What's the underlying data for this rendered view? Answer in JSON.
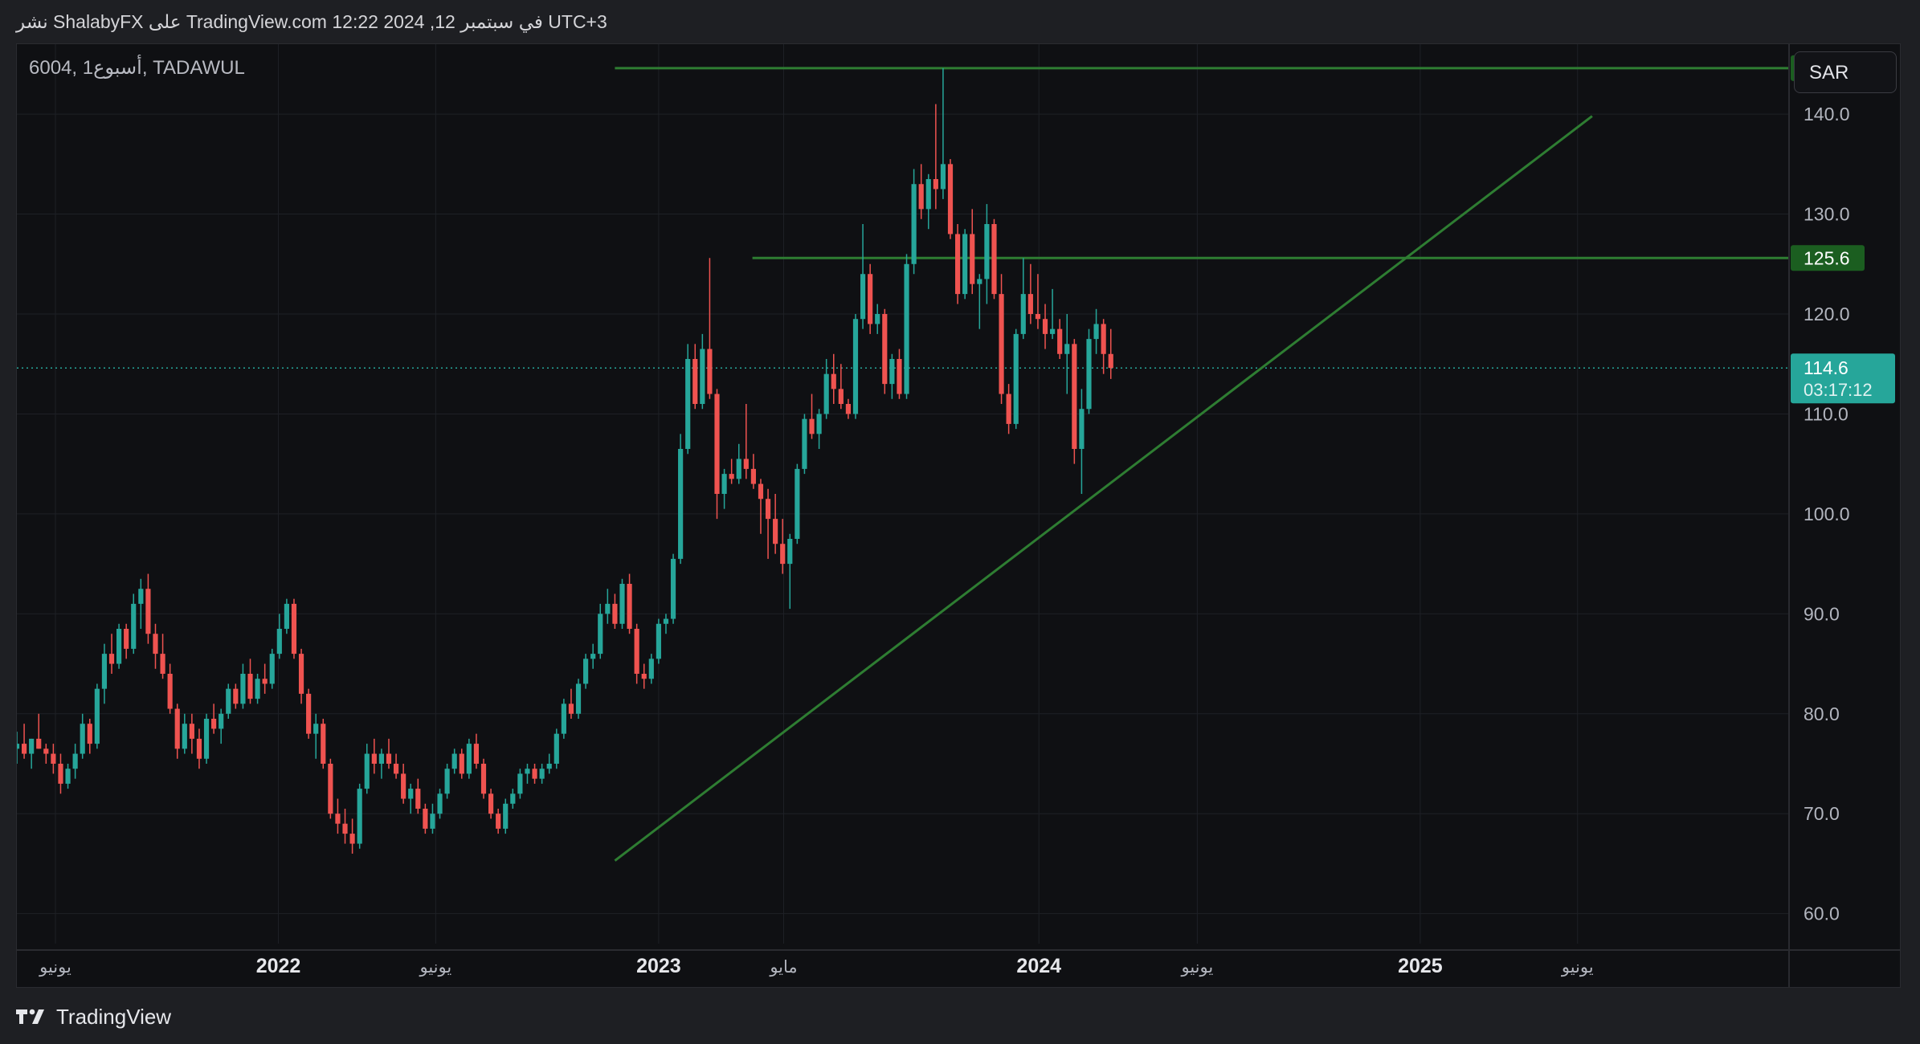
{
  "header": {
    "caption": "نشر ShalabyFX على TradingView.com في سبتمبر 12, 2024 12:22 UTC+3"
  },
  "chart_header": {
    "symbol": "6004, 1أسبوع, TADAWUL",
    "currency": "SAR"
  },
  "footer": {
    "brand": "TradingView",
    "logo_icon": "tradingview-logo-icon"
  },
  "colors": {
    "background": "#0f1013",
    "up": "#26a69a",
    "down": "#ef5350",
    "level_line": "#2e7d32",
    "level_label_bg": "#1b5e20",
    "last_price_bg": "#26a69a",
    "grid": "#1e2026",
    "axis_text": "#b2b5be"
  },
  "chart_data": {
    "type": "candlestick",
    "timeframe": "1W",
    "xlim": [
      "2021-04-25",
      "2025-12-21"
    ],
    "ylim": [
      57,
      147
    ],
    "grid": true,
    "y_ticks": [
      {
        "value": 140,
        "label": "140.0"
      },
      {
        "value": 130,
        "label": "130.0"
      },
      {
        "value": 120,
        "label": "120.0"
      },
      {
        "value": 110,
        "label": "110.0"
      },
      {
        "value": 100,
        "label": "100.0"
      },
      {
        "value": 90,
        "label": "90.0"
      },
      {
        "value": 80,
        "label": "80.0"
      },
      {
        "value": 70,
        "label": "70.0"
      },
      {
        "value": 60,
        "label": "60.0"
      }
    ],
    "x_ticks": [
      {
        "date": "2021-06-01",
        "label": "يونيو",
        "bold": false
      },
      {
        "date": "2022-01-01",
        "label": "2022",
        "bold": true
      },
      {
        "date": "2022-06-01",
        "label": "يونيو",
        "bold": false
      },
      {
        "date": "2023-01-01",
        "label": "2023",
        "bold": true
      },
      {
        "date": "2023-05-01",
        "label": "مايو",
        "bold": false
      },
      {
        "date": "2024-01-01",
        "label": "2024",
        "bold": true
      },
      {
        "date": "2024-06-01",
        "label": "يونيو",
        "bold": false
      },
      {
        "date": "2025-01-01",
        "label": "2025",
        "bold": true
      },
      {
        "date": "2025-06-01",
        "label": "يونيو",
        "bold": false
      }
    ],
    "levels": [
      {
        "price": 144.6,
        "label": "144.6",
        "start": "2022-11-20"
      },
      {
        "price": 125.6,
        "label": "125.6",
        "start": "2023-04-01"
      }
    ],
    "trendline": {
      "from": {
        "date": "2022-11-20",
        "price": 65.3
      },
      "to": {
        "date": "2025-06-15",
        "price": 139.8
      }
    },
    "last_price": {
      "value": 114.6,
      "label": "114.6",
      "countdown": "03:17:12"
    },
    "candles_start": "2021-04-25",
    "candles": [
      [
        76.5,
        78.2,
        75.0,
        77.0
      ],
      [
        77.0,
        79.0,
        75.5,
        76.0
      ],
      [
        76.0,
        77.5,
        74.5,
        77.5
      ],
      [
        77.5,
        80.0,
        76.5,
        76.5
      ],
      [
        76.5,
        77.0,
        75.0,
        76.0
      ],
      [
        76.0,
        77.0,
        74.0,
        75.0
      ],
      [
        75.0,
        76.0,
        72.0,
        73.0
      ],
      [
        73.0,
        75.0,
        72.5,
        74.5
      ],
      [
        74.5,
        77.0,
        73.5,
        76.0
      ],
      [
        76.0,
        80.0,
        75.5,
        79.0
      ],
      [
        79.0,
        79.5,
        76.0,
        77.0
      ],
      [
        77.0,
        83.0,
        76.5,
        82.5
      ],
      [
        82.5,
        87.0,
        81.0,
        86.0
      ],
      [
        86.0,
        88.0,
        84.0,
        85.0
      ],
      [
        85.0,
        89.0,
        84.5,
        88.5
      ],
      [
        88.5,
        89.0,
        85.5,
        86.5
      ],
      [
        86.5,
        92.0,
        86.0,
        91.0
      ],
      [
        91.0,
        93.5,
        88.5,
        92.5
      ],
      [
        92.5,
        94.0,
        87.0,
        88.0
      ],
      [
        88.0,
        89.0,
        84.5,
        86.0
      ],
      [
        86.0,
        88.0,
        83.5,
        84.0
      ],
      [
        84.0,
        85.0,
        80.0,
        80.5
      ],
      [
        80.5,
        81.0,
        75.5,
        76.5
      ],
      [
        76.5,
        80.0,
        76.0,
        79.0
      ],
      [
        79.0,
        80.0,
        76.0,
        77.5
      ],
      [
        77.5,
        78.5,
        74.5,
        75.5
      ],
      [
        75.5,
        80.0,
        75.0,
        79.5
      ],
      [
        79.5,
        81.0,
        78.0,
        78.5
      ],
      [
        78.5,
        80.5,
        77.0,
        80.0
      ],
      [
        80.0,
        83.0,
        79.5,
        82.5
      ],
      [
        82.5,
        83.0,
        80.5,
        81.0
      ],
      [
        81.0,
        85.0,
        80.5,
        84.0
      ],
      [
        84.0,
        85.5,
        81.0,
        81.5
      ],
      [
        81.5,
        84.0,
        81.0,
        83.5
      ],
      [
        83.5,
        85.0,
        82.0,
        83.0
      ],
      [
        83.0,
        86.5,
        82.5,
        86.0
      ],
      [
        86.0,
        90.0,
        85.5,
        88.5
      ],
      [
        88.5,
        91.5,
        88.0,
        91.0
      ],
      [
        91.0,
        91.5,
        85.5,
        86.0
      ],
      [
        86.0,
        86.5,
        81.0,
        82.0
      ],
      [
        82.0,
        82.5,
        77.5,
        78.0
      ],
      [
        78.0,
        80.0,
        75.5,
        79.0
      ],
      [
        79.0,
        79.5,
        74.5,
        75.0
      ],
      [
        75.0,
        75.5,
        69.5,
        70.0
      ],
      [
        70.0,
        71.5,
        68.0,
        69.0
      ],
      [
        69.0,
        70.5,
        67.0,
        68.0
      ],
      [
        68.0,
        69.5,
        66.0,
        67.0
      ],
      [
        67.0,
        73.0,
        66.5,
        72.5
      ],
      [
        72.5,
        77.0,
        72.0,
        76.0
      ],
      [
        76.0,
        77.5,
        74.0,
        75.0
      ],
      [
        75.0,
        76.5,
        73.5,
        76.0
      ],
      [
        76.0,
        77.5,
        74.5,
        75.0
      ],
      [
        75.0,
        76.0,
        73.5,
        74.0
      ],
      [
        74.0,
        75.0,
        71.0,
        71.5
      ],
      [
        71.5,
        73.0,
        70.0,
        72.5
      ],
      [
        72.5,
        73.5,
        70.0,
        70.5
      ],
      [
        70.5,
        71.0,
        68.0,
        68.5
      ],
      [
        68.5,
        71.0,
        68.0,
        70.0
      ],
      [
        70.0,
        72.5,
        69.5,
        72.0
      ],
      [
        72.0,
        75.0,
        71.5,
        74.5
      ],
      [
        74.5,
        76.5,
        74.0,
        76.0
      ],
      [
        76.0,
        76.5,
        73.5,
        74.0
      ],
      [
        74.0,
        77.5,
        73.5,
        77.0
      ],
      [
        77.0,
        78.0,
        74.5,
        75.0
      ],
      [
        75.0,
        75.5,
        71.5,
        72.0
      ],
      [
        72.0,
        72.5,
        69.5,
        70.0
      ],
      [
        70.0,
        70.5,
        68.0,
        68.5
      ],
      [
        68.5,
        71.5,
        68.0,
        71.0
      ],
      [
        71.0,
        72.5,
        70.5,
        72.0
      ],
      [
        72.0,
        74.5,
        71.5,
        74.0
      ],
      [
        74.0,
        75.0,
        73.0,
        74.5
      ],
      [
        74.5,
        75.0,
        73.0,
        73.5
      ],
      [
        73.5,
        75.0,
        73.0,
        74.5
      ],
      [
        74.5,
        76.0,
        74.0,
        75.0
      ],
      [
        75.0,
        78.5,
        74.5,
        78.0
      ],
      [
        78.0,
        81.5,
        77.5,
        81.0
      ],
      [
        81.0,
        82.5,
        79.5,
        80.0
      ],
      [
        80.0,
        83.5,
        79.5,
        83.0
      ],
      [
        83.0,
        86.0,
        82.5,
        85.5
      ],
      [
        85.5,
        87.0,
        84.5,
        86.0
      ],
      [
        86.0,
        91.0,
        85.5,
        90.0
      ],
      [
        90.0,
        92.5,
        89.0,
        91.0
      ],
      [
        91.0,
        92.0,
        88.5,
        89.0
      ],
      [
        89.0,
        93.5,
        88.5,
        93.0
      ],
      [
        93.0,
        94.0,
        88.0,
        88.5
      ],
      [
        88.5,
        89.0,
        83.0,
        84.0
      ],
      [
        84.0,
        85.0,
        82.5,
        83.5
      ],
      [
        83.5,
        86.0,
        83.0,
        85.5
      ],
      [
        85.5,
        89.5,
        85.0,
        89.0
      ],
      [
        89.0,
        90.0,
        88.0,
        89.5
      ],
      [
        89.5,
        96.0,
        89.0,
        95.5
      ],
      [
        95.5,
        108.0,
        95.0,
        106.5
      ],
      [
        106.5,
        117.0,
        106.0,
        115.5
      ],
      [
        115.5,
        117.0,
        110.5,
        111.0
      ],
      [
        111.0,
        118.0,
        110.5,
        116.5
      ],
      [
        116.5,
        125.6,
        111.5,
        112.0
      ],
      [
        112.0,
        112.5,
        99.5,
        102.0
      ],
      [
        102.0,
        104.5,
        100.5,
        104.0
      ],
      [
        104.0,
        105.5,
        103.0,
        103.5
      ],
      [
        103.5,
        107.0,
        103.0,
        105.5
      ],
      [
        105.5,
        111.0,
        103.5,
        104.5
      ],
      [
        104.5,
        106.0,
        102.5,
        103.0
      ],
      [
        103.0,
        103.5,
        98.0,
        101.5
      ],
      [
        101.5,
        102.5,
        95.5,
        99.5
      ],
      [
        99.5,
        102.0,
        96.0,
        97.0
      ],
      [
        97.0,
        99.5,
        94.0,
        95.0
      ],
      [
        95.0,
        98.0,
        90.5,
        97.5
      ],
      [
        97.5,
        105.0,
        97.0,
        104.5
      ],
      [
        104.5,
        110.0,
        104.0,
        109.5
      ],
      [
        109.5,
        112.0,
        107.5,
        108.0
      ],
      [
        108.0,
        110.5,
        106.5,
        110.0
      ],
      [
        110.0,
        115.5,
        109.5,
        114.0
      ],
      [
        114.0,
        116.0,
        111.0,
        112.5
      ],
      [
        112.5,
        115.0,
        110.5,
        111.0
      ],
      [
        111.0,
        111.5,
        109.5,
        110.0
      ],
      [
        110.0,
        120.0,
        109.5,
        119.5
      ],
      [
        119.5,
        129.0,
        118.5,
        124.0
      ],
      [
        124.0,
        125.0,
        118.0,
        119.0
      ],
      [
        119.0,
        121.0,
        118.0,
        120.0
      ],
      [
        120.0,
        120.5,
        112.0,
        113.0
      ],
      [
        113.0,
        116.0,
        111.5,
        115.5
      ],
      [
        115.5,
        116.5,
        111.5,
        112.0
      ],
      [
        112.0,
        126.0,
        111.5,
        125.0
      ],
      [
        125.0,
        134.5,
        124.0,
        133.0
      ],
      [
        133.0,
        135.0,
        129.5,
        130.5
      ],
      [
        130.5,
        134.0,
        128.5,
        133.5
      ],
      [
        133.5,
        141.0,
        130.5,
        132.5
      ],
      [
        132.5,
        144.6,
        131.5,
        135.0
      ],
      [
        135.0,
        135.5,
        127.5,
        128.0
      ],
      [
        128.0,
        129.0,
        121.0,
        122.0
      ],
      [
        122.0,
        128.5,
        121.5,
        128.0
      ],
      [
        128.0,
        130.5,
        122.0,
        123.0
      ],
      [
        123.0,
        124.0,
        118.5,
        123.5
      ],
      [
        123.5,
        131.0,
        121.0,
        129.0
      ],
      [
        129.0,
        129.5,
        121.5,
        122.0
      ],
      [
        122.0,
        124.0,
        111.0,
        112.0
      ],
      [
        112.0,
        113.0,
        108.0,
        109.0
      ],
      [
        109.0,
        118.5,
        108.5,
        118.0
      ],
      [
        118.0,
        125.6,
        117.5,
        122.0
      ],
      [
        122.0,
        125.0,
        119.0,
        120.0
      ],
      [
        120.0,
        124.0,
        118.5,
        119.5
      ],
      [
        119.5,
        121.0,
        116.5,
        118.0
      ],
      [
        118.0,
        122.5,
        117.5,
        118.5
      ],
      [
        118.5,
        119.5,
        115.5,
        116.0
      ],
      [
        116.0,
        120.0,
        112.0,
        117.0
      ],
      [
        117.0,
        117.5,
        105.0,
        106.5
      ],
      [
        106.5,
        112.5,
        102.0,
        110.5
      ],
      [
        110.5,
        118.5,
        110.0,
        117.5
      ],
      [
        117.5,
        120.5,
        116.0,
        119.0
      ],
      [
        119.0,
        119.5,
        114.0,
        116.0
      ],
      [
        116.0,
        118.5,
        113.5,
        114.6
      ]
    ]
  }
}
